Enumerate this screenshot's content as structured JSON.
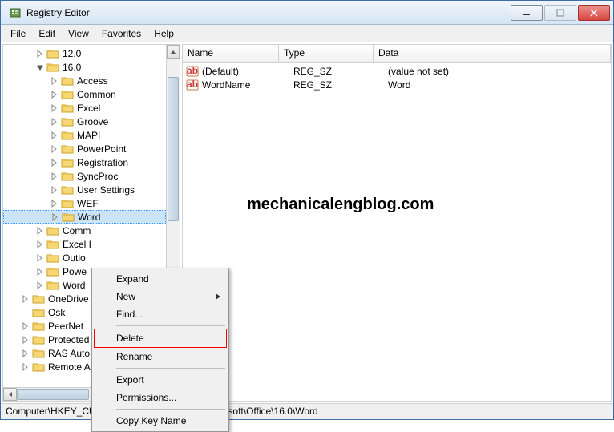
{
  "window": {
    "title": "Registry Editor"
  },
  "menu": {
    "file": "File",
    "edit": "Edit",
    "view": "View",
    "favorites": "Favorites",
    "help": "Help"
  },
  "tree": [
    {
      "indent": 2,
      "expander": "closed",
      "label": "12.0",
      "selected": false
    },
    {
      "indent": 2,
      "expander": "open",
      "label": "16.0",
      "selected": false
    },
    {
      "indent": 3,
      "expander": "closed",
      "label": "Access",
      "selected": false
    },
    {
      "indent": 3,
      "expander": "closed",
      "label": "Common",
      "selected": false
    },
    {
      "indent": 3,
      "expander": "closed",
      "label": "Excel",
      "selected": false
    },
    {
      "indent": 3,
      "expander": "closed",
      "label": "Groove",
      "selected": false
    },
    {
      "indent": 3,
      "expander": "closed",
      "label": "MAPI",
      "selected": false
    },
    {
      "indent": 3,
      "expander": "closed",
      "label": "PowerPoint",
      "selected": false
    },
    {
      "indent": 3,
      "expander": "closed",
      "label": "Registration",
      "selected": false
    },
    {
      "indent": 3,
      "expander": "closed",
      "label": "SyncProc",
      "selected": false
    },
    {
      "indent": 3,
      "expander": "closed",
      "label": "User Settings",
      "selected": false
    },
    {
      "indent": 3,
      "expander": "closed",
      "label": "WEF",
      "selected": false
    },
    {
      "indent": 3,
      "expander": "closed",
      "label": "Word",
      "selected": true
    },
    {
      "indent": 2,
      "expander": "closed",
      "label": "Comm",
      "selected": false
    },
    {
      "indent": 2,
      "expander": "closed",
      "label": "Excel I",
      "selected": false
    },
    {
      "indent": 2,
      "expander": "closed",
      "label": "Outlo",
      "selected": false
    },
    {
      "indent": 2,
      "expander": "closed",
      "label": "Powe",
      "selected": false
    },
    {
      "indent": 2,
      "expander": "closed",
      "label": "Word",
      "selected": false
    },
    {
      "indent": 1,
      "expander": "closed",
      "label": "OneDrive",
      "selected": false
    },
    {
      "indent": 1,
      "expander": "none",
      "label": "Osk",
      "selected": false
    },
    {
      "indent": 1,
      "expander": "closed",
      "label": "PeerNet",
      "selected": false
    },
    {
      "indent": 1,
      "expander": "closed",
      "label": "Protected",
      "selected": false
    },
    {
      "indent": 1,
      "expander": "closed",
      "label": "RAS Auto",
      "selected": false
    },
    {
      "indent": 1,
      "expander": "closed",
      "label": "Remote A",
      "selected": false
    }
  ],
  "list": {
    "headers": {
      "name": "Name",
      "type": "Type",
      "data": "Data"
    },
    "rows": [
      {
        "name": "(Default)",
        "type": "REG_SZ",
        "data": "(value not set)"
      },
      {
        "name": "WordName",
        "type": "REG_SZ",
        "data": "Word"
      }
    ]
  },
  "watermark": "mechanicalengblog.com",
  "context_menu": {
    "expand": "Expand",
    "new": "New",
    "find": "Find...",
    "delete": "Delete",
    "rename": "Rename",
    "export": "Export",
    "permissions": "Permissions...",
    "copy_key_name": "Copy Key Name"
  },
  "statusbar": {
    "path": "Computer\\HKEY_CURRENT_USER\\Software\\Microsoft\\Office\\16.0\\Word"
  }
}
